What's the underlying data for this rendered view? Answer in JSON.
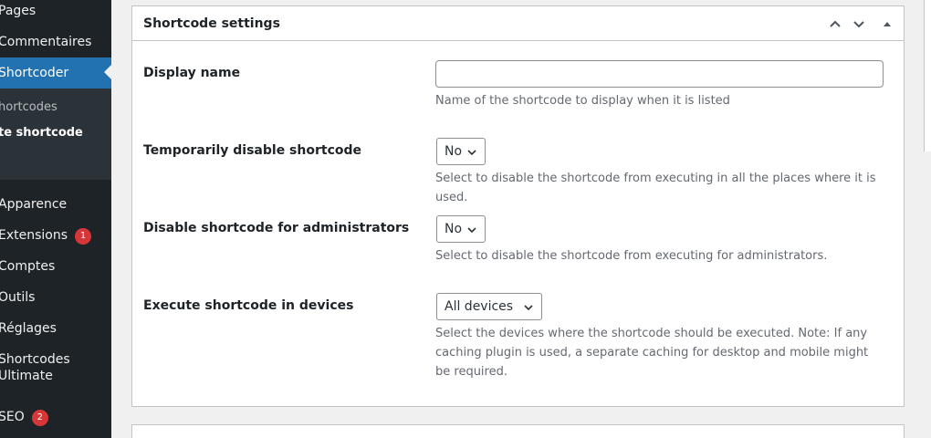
{
  "sidebar": {
    "items": [
      {
        "label": "Pages"
      },
      {
        "label": "Commentaires"
      },
      {
        "label": "Shortcoder"
      },
      {
        "label": "Apparence"
      },
      {
        "label": "Extensions",
        "badge": "1"
      },
      {
        "label": "Comptes"
      },
      {
        "label": "Outils"
      },
      {
        "label": "Réglages"
      },
      {
        "label": "Shortcodes Ultimate"
      },
      {
        "label": "SEO",
        "badge": "2"
      }
    ],
    "submenu": [
      {
        "label": "hortcodes"
      },
      {
        "label": "te shortcode"
      }
    ]
  },
  "panel": {
    "title": "Shortcode settings",
    "fields": [
      {
        "label": "Display name",
        "value": "",
        "description": "Name of the shortcode to display when it is listed"
      },
      {
        "label": "Temporarily disable shortcode",
        "value": "No",
        "description": "Select to disable the shortcode from executing in all the places where it is used."
      },
      {
        "label": "Disable shortcode for administrators",
        "value": "No",
        "description": "Select to disable the shortcode from executing for administrators."
      },
      {
        "label": "Execute shortcode in devices",
        "value": "All devices",
        "description": "Select the devices where the shortcode should be executed. Note: If any caching plugin is used, a separate caching for desktop and mobile might be required."
      }
    ]
  },
  "colors": {
    "sidebar_bg": "#1d2327",
    "active": "#2271b1",
    "badge": "#d63638"
  }
}
